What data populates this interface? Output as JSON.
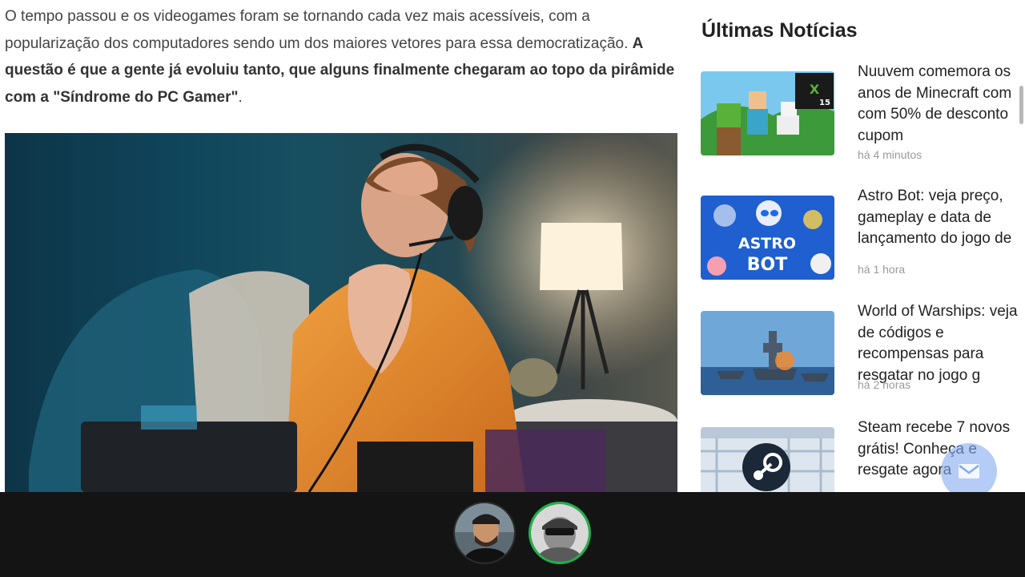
{
  "article": {
    "paragraph_plain": "O tempo passou e os videogames foram se tornando cada vez mais acessíveis, com a popularização dos computadores sendo um dos maiores vetores para essa democratização. ",
    "paragraph_bold": "A questão é que a gente já evoluiu tanto, que alguns finalmente chegaram ao topo da pirâmide com a \"Síndrome do PC Gamer\"",
    "paragraph_end": "."
  },
  "sidebar": {
    "heading": "Últimas Notícias",
    "items": [
      {
        "title": "Nuuvem comemora os anos de Minecraft com com 50% de desconto cupom",
        "time": "há 4 minutos",
        "thumb_badge": "15"
      },
      {
        "title": "Astro Bot: veja preço, gameplay e data de lançamento do jogo de",
        "time": "há 1 hora",
        "thumb_text_1": "ASTRO",
        "thumb_text_2": "BOT"
      },
      {
        "title": "World of Warships: veja de códigos e recompensas para resgatar no jogo g",
        "time": "há 2 horas"
      },
      {
        "title": "Steam recebe 7 novos grátis! Conheça e resgate agora",
        "time": ""
      }
    ]
  },
  "colors": {
    "accent_green": "#1fb24a",
    "bottom_bar": "#141414",
    "float_button": "#82aaf0"
  },
  "icons": {
    "floating_button": "mail-icon",
    "steam_logo": "steam-icon"
  }
}
